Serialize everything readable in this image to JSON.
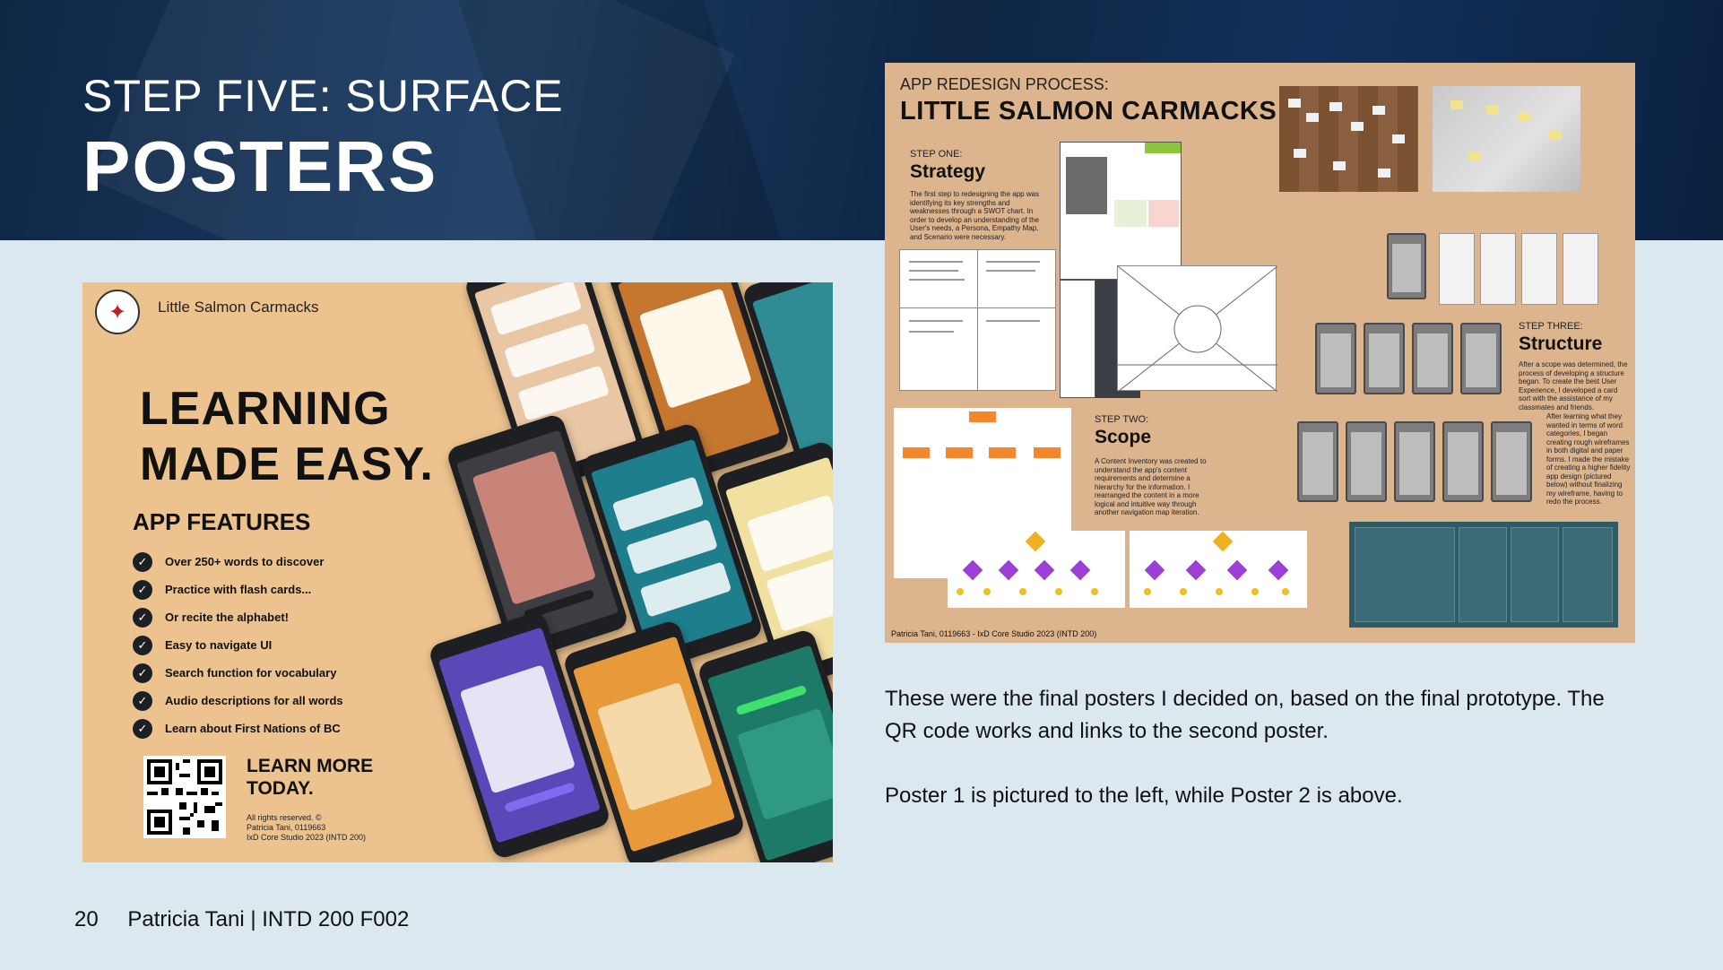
{
  "header": {
    "step_label": "STEP FIVE: SURFACE",
    "title": "POSTERS"
  },
  "poster1": {
    "brand": "Little Salmon Carmacks",
    "headline_line1": "LEARNING",
    "headline_line2": "MADE EASY.",
    "features_title": "APP FEATURES",
    "features": [
      "Over 250+ words to discover",
      "Practice with flash cards...",
      "Or recite the alphabet!",
      "Easy to navigate UI",
      "Search function for vocabulary",
      "Audio descriptions for all words",
      "Learn about First Nations of BC"
    ],
    "cta_line1": "LEARN MORE",
    "cta_line2": "TODAY.",
    "fine_print": [
      "All rights reserved. ©",
      "Patricia Tani, 0119663",
      "IxD Core Studio 2023 (INTD 200)"
    ],
    "check_glyph": "✓",
    "logo_icon": "salmon-crest-icon"
  },
  "poster2": {
    "process_label": "APP REDESIGN PROCESS:",
    "title": "LITTLE SALMON CARMACKS",
    "step1_label": "STEP ONE:",
    "step1_title": "Strategy",
    "step1_text": "The first step to redesigning the app was identifying its key strengths and weaknesses through a SWOT chart. In order to develop an understanding of the User's needs, a Persona, Empathy Map, and Scenario were necessary.",
    "step2_label": "STEP TWO:",
    "step2_title": "Scope",
    "step2_text": "A Content Inventory was created to understand the app's content requirements and determine a hierarchy for the information. I rearranged the content in a more logical and intuitive way through another navigation map iteration.",
    "step3_label": "STEP THREE:",
    "step3_title": "Structure",
    "step3_text": "After a scope was determined, the process of developing a structure began. To create the best User Experience, I developed a card sort with the assistance of my classmates and friends.",
    "step3_text2": "After learning what they wanted in terms of word categories, I began creating rough wireframes in both digital and paper forms. I made the mistake of creating a higher fidelity app design (pictured below) without finalizing my wireframe, having to redo the process.",
    "footer": "Patricia Tani, 0119663  -  IxD Core Studio 2023 (INTD 200)"
  },
  "caption": {
    "para1": "These were the final posters I decided on, based on the final prototype. The QR code works and links to the second poster.",
    "para2": "Poster 1 is pictured to the left, while Poster 2 is above."
  },
  "footer": {
    "page_number": "20",
    "author_course": "Patricia Tani | INTD 200 F002"
  },
  "colors": {
    "header_bg": "#0f2745",
    "page_bg": "#dce8f0",
    "poster1_bg": "#ecc38e",
    "poster2_bg": "#dcb58f",
    "accent_orange": "#f4862b",
    "accent_purple": "#9b3fd6"
  }
}
